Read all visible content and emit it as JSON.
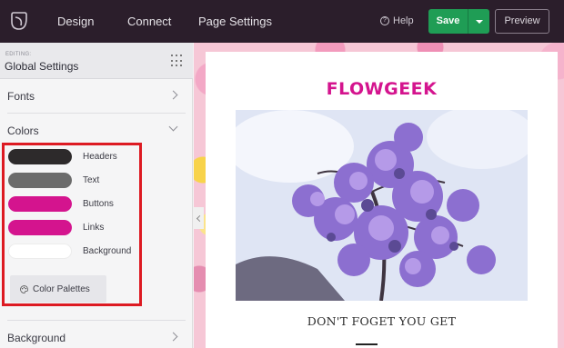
{
  "topbar": {
    "nav": [
      "Design",
      "Connect",
      "Page Settings"
    ],
    "help_label": "Help",
    "save_label": "Save",
    "preview_label": "Preview"
  },
  "sidebar": {
    "editing_label": "EDITING:",
    "editing_title": "Global Settings",
    "sections": {
      "fonts": "Fonts",
      "colors": "Colors",
      "background": "Background"
    },
    "colors": [
      {
        "label": "Headers",
        "color": "#2d2a2b"
      },
      {
        "label": "Text",
        "color": "#6b6b6b"
      },
      {
        "label": "Buttons",
        "color": "#d4148e"
      },
      {
        "label": "Links",
        "color": "#d4148e"
      },
      {
        "label": "Background",
        "color": "#ffffff"
      }
    ],
    "palettes_label": "Color Palettes"
  },
  "preview": {
    "brand": "FLOWGEEK",
    "headline": "DON'T FOGET YOU GET"
  },
  "accent": {
    "brand": "#d4148e",
    "save": "#1f9d55",
    "highlight": "#dd1a22"
  }
}
